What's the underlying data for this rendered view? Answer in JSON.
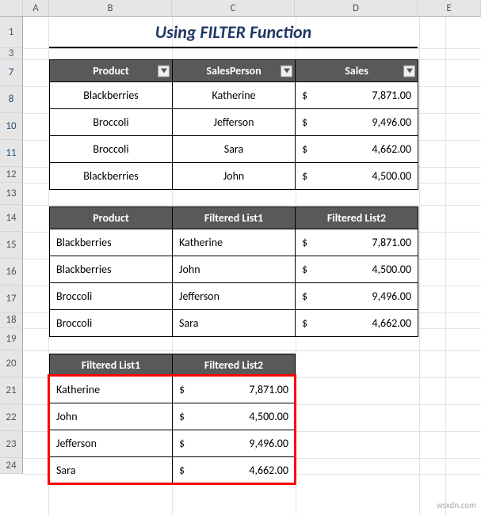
{
  "columns": {
    "A": "A",
    "B": "B",
    "C": "C",
    "D": "D",
    "E": "E"
  },
  "row_labels": [
    "1",
    "3",
    "7",
    "8",
    "10",
    "11",
    "12",
    "13",
    "14",
    "15",
    "16",
    "17",
    "18",
    "19",
    "20",
    "21",
    "22",
    "23",
    "24"
  ],
  "row_blue_indices": [
    2,
    3,
    4,
    5
  ],
  "title": "Using FILTER Function",
  "currency_symbol": "$",
  "table1": {
    "headers": {
      "product": "Product",
      "salesperson": "SalesPerson",
      "sales": "Sales"
    },
    "rows": [
      {
        "product": "Blackberries",
        "person": "Katherine",
        "sales": "7,871.00"
      },
      {
        "product": "Broccoli",
        "person": "Jefferson",
        "sales": "9,496.00"
      },
      {
        "product": "Broccoli",
        "person": "Sara",
        "sales": "4,662.00"
      },
      {
        "product": "Blackberries",
        "person": "John",
        "sales": "4,500.00"
      }
    ]
  },
  "table2": {
    "headers": {
      "product": "Product",
      "list1": "Filtered List1",
      "list2": "Filtered List2"
    },
    "rows": [
      {
        "product": "Blackberries",
        "person": "Katherine",
        "sales": "7,871.00"
      },
      {
        "product": "Blackberries",
        "person": "John",
        "sales": "4,500.00"
      },
      {
        "product": "Broccoli",
        "person": "Jefferson",
        "sales": "9,496.00"
      },
      {
        "product": "Broccoli",
        "person": "Sara",
        "sales": "4,662.00"
      }
    ]
  },
  "table3": {
    "headers": {
      "list1": "Filtered List1",
      "list2": "Filtered List2"
    },
    "rows": [
      {
        "person": "Katherine",
        "sales": "7,871.00"
      },
      {
        "person": "John",
        "sales": "4,500.00"
      },
      {
        "person": "Jefferson",
        "sales": "9,496.00"
      },
      {
        "person": "Sara",
        "sales": "4,662.00"
      }
    ]
  },
  "watermark": "wsxdn.com"
}
